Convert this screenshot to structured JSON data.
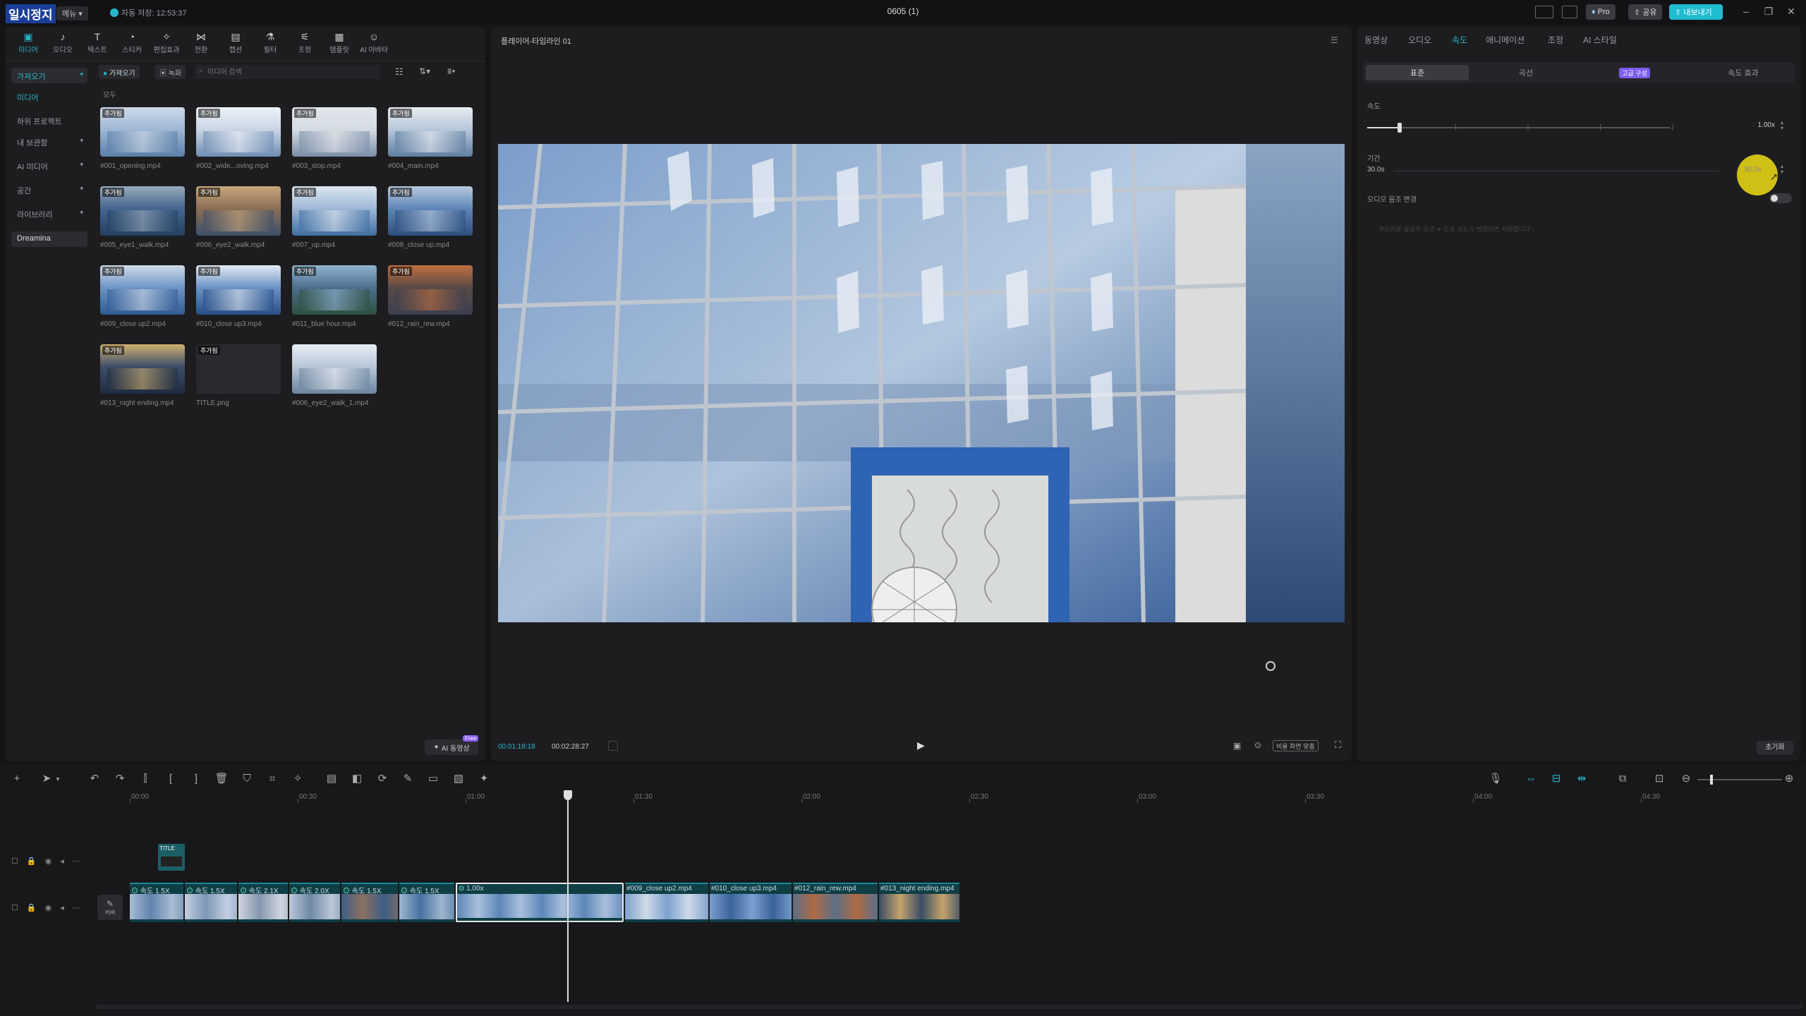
{
  "titlebar": {
    "logo": "일시정지",
    "menu": "메뉴",
    "autosave": "자동 저장: 12:53:37",
    "title": "0605 (1)",
    "pro": "Pro",
    "share": "공유",
    "export": "내보내기"
  },
  "media": {
    "tools": [
      {
        "label": "미디어",
        "icon": "media-icon"
      },
      {
        "label": "오디오",
        "icon": "audio-icon"
      },
      {
        "label": "텍스트",
        "icon": "text-icon"
      },
      {
        "label": "스티커",
        "icon": "sticker-icon"
      },
      {
        "label": "편집효과",
        "icon": "effects-icon"
      },
      {
        "label": "전환",
        "icon": "transition-icon"
      },
      {
        "label": "캡션",
        "icon": "caption-icon"
      },
      {
        "label": "필터",
        "icon": "filter-icon"
      },
      {
        "label": "조정",
        "icon": "adjust-icon"
      },
      {
        "label": "템플릿",
        "icon": "template-icon"
      },
      {
        "label": "AI 아바타",
        "icon": "avatar-icon"
      }
    ],
    "sidebar": [
      {
        "label": "가져오기"
      },
      {
        "label": "미디어"
      },
      {
        "label": "하위 프로젝트"
      },
      {
        "label": "내 보관함"
      },
      {
        "label": "AI 미디어"
      },
      {
        "label": "공간"
      },
      {
        "label": "라이브러리"
      },
      {
        "label": "Dreamina"
      }
    ],
    "import_btn": "가져오기",
    "record_btn": "녹화",
    "search_placeholder": "미디어 검색",
    "section": "모두",
    "items": [
      {
        "name": "#001_opening.mp4",
        "badge": "추가됨"
      },
      {
        "name": "#002_wide...oving.mp4",
        "badge": "추가됨"
      },
      {
        "name": "#003_stop.mp4",
        "badge": "추가됨"
      },
      {
        "name": "#004_main.mp4",
        "badge": "추가됨"
      },
      {
        "name": "#005_eye1_walk.mp4",
        "badge": "추가됨"
      },
      {
        "name": "#006_eye2_walk.mp4",
        "badge": "추가됨"
      },
      {
        "name": "#007_up.mp4",
        "badge": "추가됨"
      },
      {
        "name": "#008_close up.mp4",
        "badge": "추가됨"
      },
      {
        "name": "#009_close up2.mp4",
        "badge": "추가됨"
      },
      {
        "name": "#010_close up3.mp4",
        "badge": "추가됨"
      },
      {
        "name": "#011_blue hour.mp4",
        "badge": "추가됨"
      },
      {
        "name": "#012_rain_rew.mp4",
        "badge": "추가됨"
      },
      {
        "name": "#013_night ending.mp4",
        "badge": "추가됨"
      },
      {
        "name": "TITLE.png",
        "badge": "추가됨"
      },
      {
        "name": "#006_eye2_walk_1.mp4",
        "badge": ""
      }
    ],
    "ai_btn": "AI 동영상",
    "ai_badge": "Free"
  },
  "player": {
    "title": "플레이어-타임라인 01",
    "time_current": "00:01:18:18",
    "time_total": "00:02:28:27",
    "ratio_label": "비율 화면 맞춤"
  },
  "inspector": {
    "tabs": [
      "동영상",
      "오디오",
      "속도",
      "애니메이션",
      "조정",
      "AI 스타일"
    ],
    "active_tab": "속도",
    "segments": [
      "표준",
      "곡선",
      "고급 구성",
      "속도 효과"
    ],
    "speed_label": "속도",
    "speed_value": "1.00x",
    "speed_fraction": 0.1,
    "duration_label": "기간",
    "duration_start": "30.0s",
    "duration_end": "30.0s",
    "pitch_label": "오디오 음조 변경",
    "hint": "부드러운 슬로우 모션 ✦ 으로 속도가 변경되면 지원합니다 ›",
    "reset": "초기화"
  },
  "timeline": {
    "ruler": [
      "00:00",
      "00:30",
      "01:00",
      "01:30",
      "02:00",
      "02:30",
      "03:00",
      "03:30",
      "04:00",
      "04:30"
    ],
    "title_clip": "TITLE",
    "cover": "커버",
    "clips": [
      {
        "label": "속도 1.5X"
      },
      {
        "label": "속도 1.5X"
      },
      {
        "label": "속도 2.1X"
      },
      {
        "label": "속도 2.0X"
      },
      {
        "label": "속도 1.5X"
      },
      {
        "label": "속도 1.5X"
      },
      {
        "label": "1.00x"
      },
      {
        "label": "#009_close up2.mp4"
      },
      {
        "label": "#010_close up3.mp4"
      },
      {
        "label": "#012_rain_rew.mp4"
      },
      {
        "label": "#013_night ending.mp4"
      }
    ],
    "playhead_fraction": 0.263
  },
  "colors": {
    "accent": "#27b6c7",
    "panel": "#1d1d20",
    "clip": "#0f3f44"
  }
}
